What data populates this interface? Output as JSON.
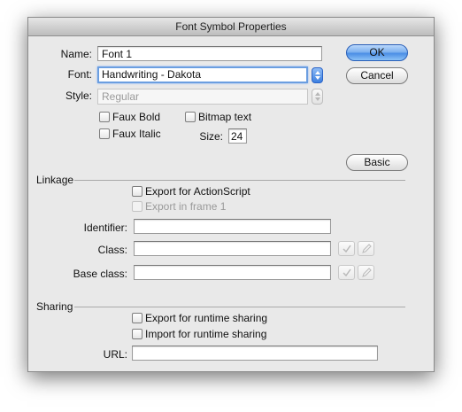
{
  "dialog": {
    "title": "Font Symbol Properties"
  },
  "form": {
    "name_label": "Name:",
    "name_value": "Font 1",
    "font_label": "Font:",
    "font_value": "Handwriting - Dakota",
    "style_label": "Style:",
    "style_value": "Regular",
    "faux_bold": {
      "label": "Faux Bold",
      "checked": false
    },
    "faux_italic": {
      "label": "Faux Italic",
      "checked": false
    },
    "bitmap_text": {
      "label": "Bitmap text",
      "checked": false
    },
    "size_label": "Size:",
    "size_value": "24"
  },
  "buttons": {
    "ok": "OK",
    "cancel": "Cancel",
    "basic": "Basic"
  },
  "linkage": {
    "title": "Linkage",
    "export_actionscript": {
      "label": "Export for ActionScript",
      "checked": false
    },
    "export_frame1": {
      "label": "Export in frame 1",
      "checked": false,
      "disabled": true
    },
    "identifier_label": "Identifier:",
    "identifier_value": "",
    "class_label": "Class:",
    "class_value": "",
    "base_class_label": "Base class:",
    "base_class_value": ""
  },
  "sharing": {
    "title": "Sharing",
    "export_runtime": {
      "label": "Export for runtime sharing",
      "checked": false
    },
    "import_runtime": {
      "label": "Import for runtime sharing",
      "checked": false
    },
    "url_label": "URL:",
    "url_value": ""
  },
  "icons": {
    "validate": "checkmark-icon",
    "edit": "pencil-icon",
    "stepper": "updown-stepper-icon"
  },
  "colors": {
    "default_button": "#4b8ee6",
    "focus_ring": "#6b9ee0"
  }
}
